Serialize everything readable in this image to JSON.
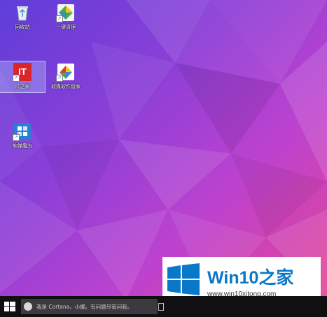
{
  "desktop": {
    "icons": [
      {
        "label": "回收站",
        "icon": "recycle-bin-icon"
      },
      {
        "label": "一键清理",
        "icon": "one-click-clean-icon"
      },
      {
        "label": "IT之家",
        "icon": "ithome-icon",
        "badge": "IT"
      },
      {
        "label": "软媒软件管家",
        "icon": "software-manager-icon"
      },
      {
        "label": "软媒魔方",
        "icon": "rm-cube-icon"
      }
    ]
  },
  "taskbar": {
    "search_placeholder": "我是 Cortana，小娜。有问题尽管问我。"
  },
  "watermark": {
    "brand": "Win10",
    "brand_suffix": "之家",
    "url": "www.win10xitong.com"
  },
  "colors": {
    "accent_blue": "#0a78c8",
    "taskbar_bg": "#101012",
    "search_bg": "#3b3b3f"
  }
}
